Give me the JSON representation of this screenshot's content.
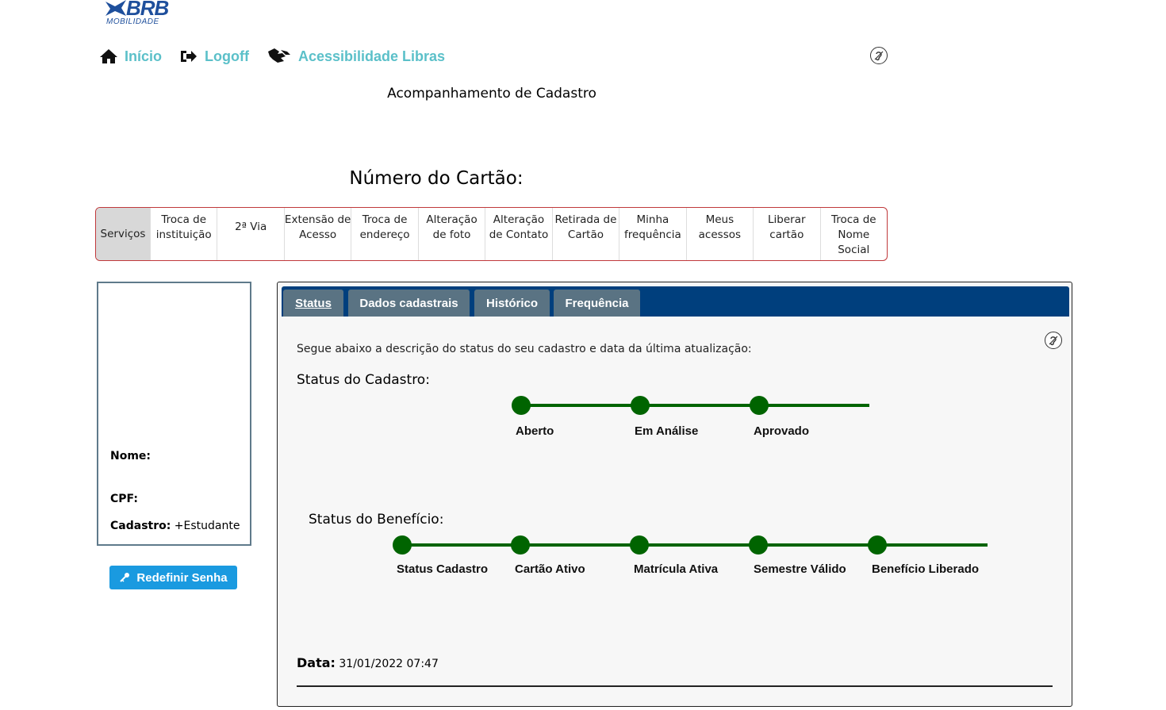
{
  "logo": {
    "brand": "BRB",
    "sub": "MOBILIDADE"
  },
  "nav": {
    "inicio": "Início",
    "logoff": "Logoff",
    "libras": "Acessibilidade Libras"
  },
  "page_title": "Acompanhamento de Cadastro",
  "card_number_label": "Número do Cartão:",
  "services": [
    "Serviços",
    "Troca de instituição",
    "2ª Via",
    "Extensão de Acesso",
    "Troca de endereço",
    "Alteração de foto",
    "Alteração de Contato",
    "Retirada de Cartão",
    "Minha frequência",
    "Meus acessos",
    "Liberar cartão",
    "Troca de Nome Social"
  ],
  "profile": {
    "nome_label": "Nome:",
    "cpf_label": "CPF:",
    "cadastro_label": "Cadastro:",
    "cadastro_value": "+Estudante"
  },
  "reset_button": "Redefinir Senha",
  "tabs": [
    "Status",
    "Dados cadastrais",
    "Histórico",
    "Frequência"
  ],
  "status": {
    "description": "Segue abaixo a descrição do status do seu cadastro e data da última atualização:",
    "cadastro_heading": "Status do Cadastro:",
    "cadastro_steps": [
      "Aberto",
      "Em Análise",
      "Aprovado"
    ],
    "beneficio_heading": "Status do Benefício:",
    "beneficio_steps": [
      "Status Cadastro",
      "Cartão Ativo",
      "Matrícula Ativa",
      "Semestre Válido",
      "Benefício Liberado"
    ],
    "date_label": "Data:",
    "date_value": "31/01/2022 07:47"
  },
  "colors": {
    "nav_link": "#5bc0c9",
    "tabbar": "#003f7d",
    "tab": "#5a7383",
    "progress": "#006400",
    "button": "#1a9ae0",
    "services_border": "#c0393b"
  }
}
